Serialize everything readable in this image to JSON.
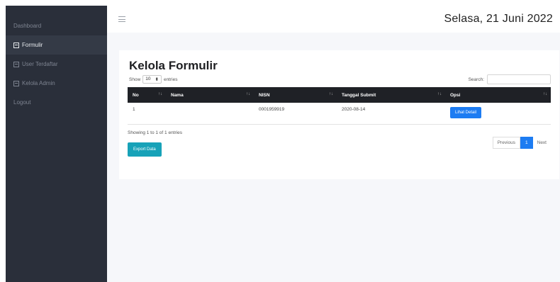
{
  "sidebar": {
    "items": [
      {
        "label": "Dashboard",
        "icon": "none"
      },
      {
        "label": "Formulir",
        "icon": "form-icon",
        "active": true
      },
      {
        "label": "User Terdaftar",
        "icon": "form-icon"
      },
      {
        "label": "Kelola Admin",
        "icon": "form-icon"
      },
      {
        "label": "Logout",
        "icon": "none"
      }
    ]
  },
  "header": {
    "menu_icon": "hamburger-icon",
    "date": "Selasa, 21 Juni 2022"
  },
  "main": {
    "title": "Kelola Formulir",
    "length": {
      "show": "Show",
      "value": "10",
      "entries": "entries"
    },
    "search": {
      "label": "Search:",
      "value": ""
    },
    "table": {
      "headers": [
        "No",
        "Nama",
        "NISN",
        "Tanggal Submit",
        "Opsi"
      ],
      "rows": [
        {
          "no": "1",
          "nama": "",
          "nisn": "0001959919",
          "tanggal": "2020-08-14",
          "action": "Lihat Detail"
        }
      ]
    },
    "info": "Showing 1 to 1 of 1 entries",
    "pagination": {
      "previous": "Previous",
      "current": "1",
      "next": "Next"
    },
    "export_label": "Export Data"
  },
  "colors": {
    "sidebar": "#2a2f3a",
    "table_header": "#1f2126",
    "primary": "#1d7cf2",
    "export": "#17a2b8"
  }
}
